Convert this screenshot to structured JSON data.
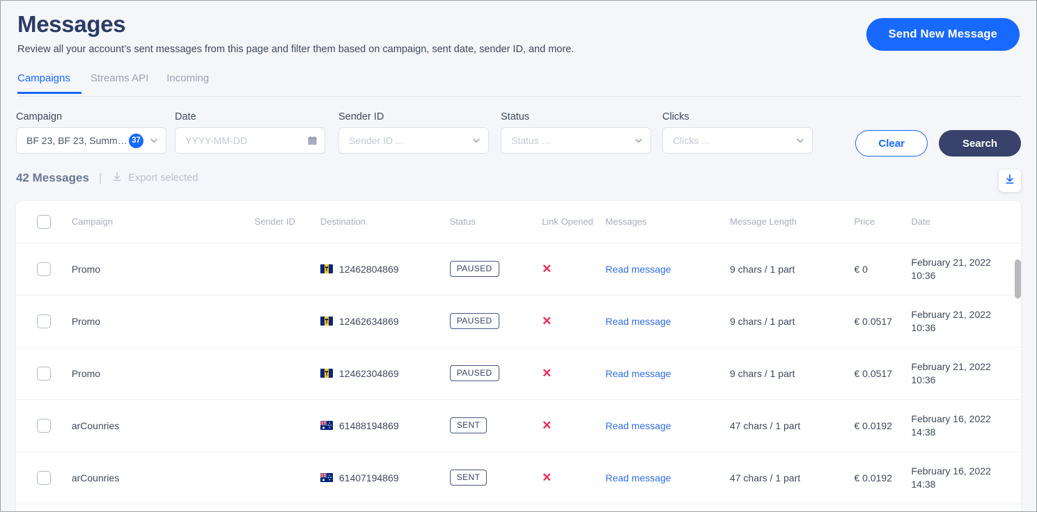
{
  "header": {
    "title": "Messages",
    "subtitle": "Review all your account’s sent messages from this page and filter them based on campaign, sent date, sender ID, and more.",
    "cta_label": "Send New Message"
  },
  "tabs": [
    {
      "label": "Campaigns",
      "active": true
    },
    {
      "label": "Streams API",
      "active": false
    },
    {
      "label": "Incoming",
      "active": false
    }
  ],
  "filters": {
    "campaign": {
      "label": "Campaign",
      "value": "BF 23, BF 23, Summ…",
      "badge": "37"
    },
    "date": {
      "label": "Date",
      "placeholder": "YYYY-MM-DD",
      "value": ""
    },
    "sender_id": {
      "label": "Sender ID",
      "placeholder": "Sender ID ...",
      "value": ""
    },
    "status": {
      "label": "Status",
      "placeholder": "Status ...",
      "value": ""
    },
    "clicks": {
      "label": "Clicks",
      "placeholder": "Clicks ...",
      "value": ""
    },
    "clear_label": "Clear",
    "search_label": "Search"
  },
  "summary": {
    "count_label": "42 Messages",
    "separator": "|",
    "export_label": "Export selected"
  },
  "table": {
    "columns": [
      "Campaign",
      "Sender ID",
      "Destination",
      "Status",
      "Link Opened",
      "Messages",
      "Message Length",
      "Price",
      "Date"
    ],
    "rows": [
      {
        "campaign": "Promo",
        "sender_id": "",
        "destination": "12462804869",
        "flag": "barbados-flag",
        "status": "PAUSED",
        "link_opened": "✕",
        "messages": "Read message",
        "message_length": "9 chars / 1 part",
        "price": "€ 0",
        "date": "February 21, 2022",
        "time": "10:36"
      },
      {
        "campaign": "Promo",
        "sender_id": "",
        "destination": "12462634869",
        "flag": "barbados-flag",
        "status": "PAUSED",
        "link_opened": "✕",
        "messages": "Read message",
        "message_length": "9 chars / 1 part",
        "price": "€ 0.0517",
        "date": "February 21, 2022",
        "time": "10:36"
      },
      {
        "campaign": "Promo",
        "sender_id": "",
        "destination": "12462304869",
        "flag": "barbados-flag",
        "status": "PAUSED",
        "link_opened": "✕",
        "messages": "Read message",
        "message_length": "9 chars / 1 part",
        "price": "€ 0.0517",
        "date": "February 21, 2022",
        "time": "10:36"
      },
      {
        "campaign": "arCounries",
        "sender_id": "",
        "destination": "61488194869",
        "flag": "australia-flag",
        "status": "SENT",
        "link_opened": "✕",
        "messages": "Read message",
        "message_length": "47 chars / 1 part",
        "price": "€ 0.0192",
        "date": "February 16, 2022",
        "time": "14:38"
      },
      {
        "campaign": "arCounries",
        "sender_id": "",
        "destination": "61407194869",
        "flag": "australia-flag",
        "status": "SENT",
        "link_opened": "✕",
        "messages": "Read message",
        "message_length": "47 chars / 1 part",
        "price": "€ 0.0192",
        "date": "February 16, 2022",
        "time": "14:38"
      }
    ]
  },
  "colors": {
    "accent_blue": "#1769ff",
    "dark_navy": "#38426b",
    "title_navy": "#2b3a67",
    "danger_red": "#f0285a",
    "link_blue": "#2f6fed"
  }
}
